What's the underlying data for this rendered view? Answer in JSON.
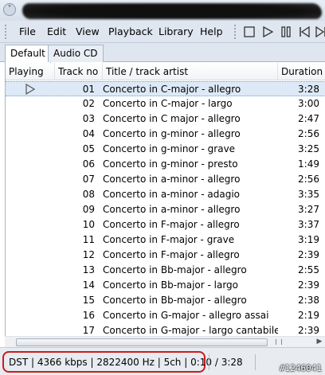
{
  "menubar": {
    "items": [
      "File",
      "Edit",
      "View",
      "Playback",
      "Library",
      "Help"
    ]
  },
  "tabs": [
    "Default",
    "Audio CD"
  ],
  "columns": {
    "playing": "Playing",
    "track_no": "Track no",
    "title": "Title / track artist",
    "duration": "Duration"
  },
  "now_playing_icon": "play-triangle-icon",
  "tracks": [
    {
      "no": "01",
      "title": "Concerto in C-major - allegro",
      "duration": "3:28"
    },
    {
      "no": "02",
      "title": "Concerto in C-major - largo",
      "duration": "3:00"
    },
    {
      "no": "03",
      "title": "Concerto in C major - allegro",
      "duration": "2:47"
    },
    {
      "no": "04",
      "title": "Concerto in g-minor - allegro",
      "duration": "2:56"
    },
    {
      "no": "05",
      "title": "Concerto in g-minor - grave",
      "duration": "3:25"
    },
    {
      "no": "06",
      "title": "Concerto in g-minor - presto",
      "duration": "1:49"
    },
    {
      "no": "07",
      "title": "Concerto in a-minor - allegro",
      "duration": "2:56"
    },
    {
      "no": "08",
      "title": "Concerto in a-minor - adagio",
      "duration": "3:35"
    },
    {
      "no": "09",
      "title": "Concerto in a-minor - allegro",
      "duration": "3:27"
    },
    {
      "no": "10",
      "title": "Concerto in F-major - allegro",
      "duration": "3:37"
    },
    {
      "no": "11",
      "title": "Concerto in F-major - grave",
      "duration": "3:19"
    },
    {
      "no": "12",
      "title": "Concerto in F-major - allegro",
      "duration": "2:39"
    },
    {
      "no": "13",
      "title": "Concerto in Bb-major - allegro",
      "duration": "2:55"
    },
    {
      "no": "14",
      "title": "Concerto in Bb-major - largo",
      "duration": "2:39"
    },
    {
      "no": "15",
      "title": "Concerto in Bb-major - allegro",
      "duration": "2:38"
    },
    {
      "no": "16",
      "title": "Concerto in G-major - allegro assai",
      "duration": "2:19"
    },
    {
      "no": "17",
      "title": "Concerto in G-major - largo cantabile",
      "duration": "2:39"
    }
  ],
  "status": {
    "text": "DST | 4366 kbps | 2822400 Hz | 5ch | 0:10 / 3:28"
  },
  "watermark": "#1246041",
  "colors": {
    "highlight_box": "#cc1b1b",
    "selected_row": "#dde9f7"
  }
}
